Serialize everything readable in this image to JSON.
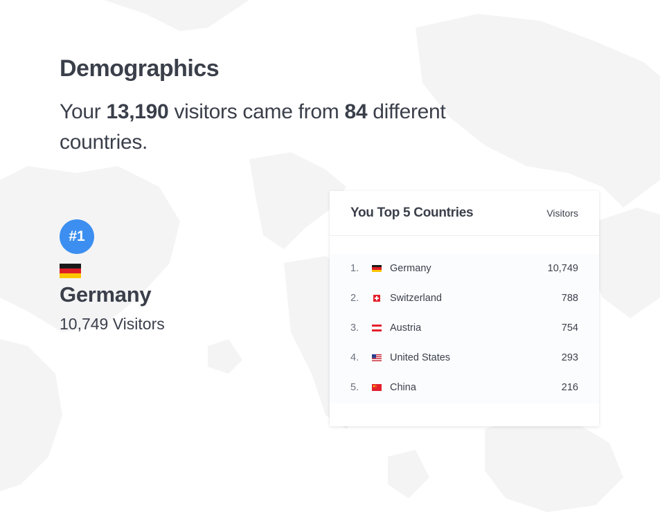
{
  "header": {
    "title": "Demographics",
    "summary": {
      "prefix": "Your ",
      "visitors": "13,190",
      "middle": " visitors came from ",
      "countries": "84",
      "suffix": " different countries."
    }
  },
  "top_country": {
    "rank": "#1",
    "flag": "germany-flag-icon",
    "name": "Germany",
    "visitors_text": "10,749 Visitors"
  },
  "top_five": {
    "title": "You Top 5 Countries",
    "column_label": "Visitors",
    "rows": [
      {
        "rank": "1.",
        "flag": "germany-flag-icon",
        "country": "Germany",
        "visitors": "10,749"
      },
      {
        "rank": "2.",
        "flag": "switzerland-flag-icon",
        "country": "Switzerland",
        "visitors": "788"
      },
      {
        "rank": "3.",
        "flag": "austria-flag-icon",
        "country": "Austria",
        "visitors": "754"
      },
      {
        "rank": "4.",
        "flag": "united-states-flag-icon",
        "country": "United States",
        "visitors": "293"
      },
      {
        "rank": "5.",
        "flag": "china-flag-icon",
        "country": "China",
        "visitors": "216"
      }
    ]
  },
  "colors": {
    "accent": "#3c8ff0",
    "text": "#3a3f4a",
    "map": "#f4f4f5"
  }
}
